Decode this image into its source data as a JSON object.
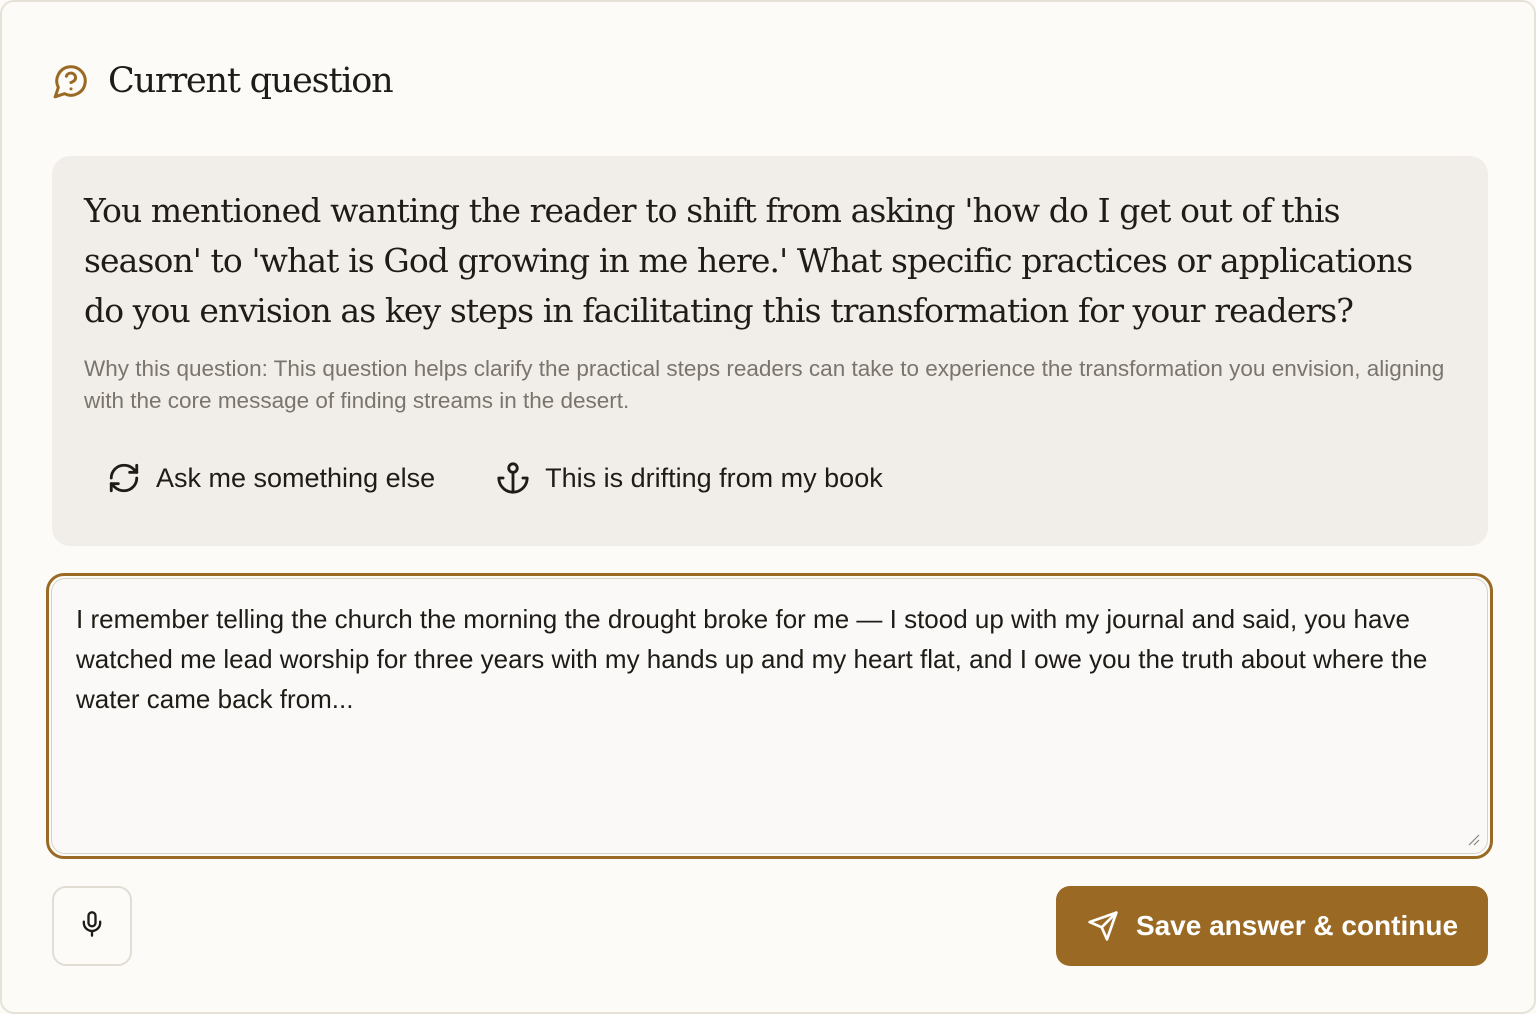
{
  "header": {
    "title": "Current question",
    "icon": "question-bubble-icon",
    "icon_color": "#9a6a24"
  },
  "question": {
    "text": "You mentioned wanting the reader to shift from asking 'how do I get out of this season' to 'what is God growing in me here.' What specific practices or applications do you envision as key steps in facilitating this transformation for your readers?",
    "why": "Why this question: This question helps clarify the practical steps readers can take to experience the transformation you envision, aligning with the core message of finding streams in the desert.",
    "actions": [
      {
        "label": "Ask me something else",
        "icon": "refresh-icon"
      },
      {
        "label": "This is drifting from my book",
        "icon": "anchor-icon"
      }
    ]
  },
  "answer": {
    "value": "I remember telling the church the morning the drought broke for me — I stood up with my journal and said, you have watched me lead worship for three years with my hands up and my heart flat, and I owe you the truth about where the water came back from..."
  },
  "footer": {
    "mic_icon": "microphone-icon",
    "save_label": "Save answer & continue",
    "save_icon": "send-icon"
  },
  "colors": {
    "accent": "#9a6a24",
    "question_bg": "#f1eeea",
    "muted_text": "#7a746c"
  }
}
